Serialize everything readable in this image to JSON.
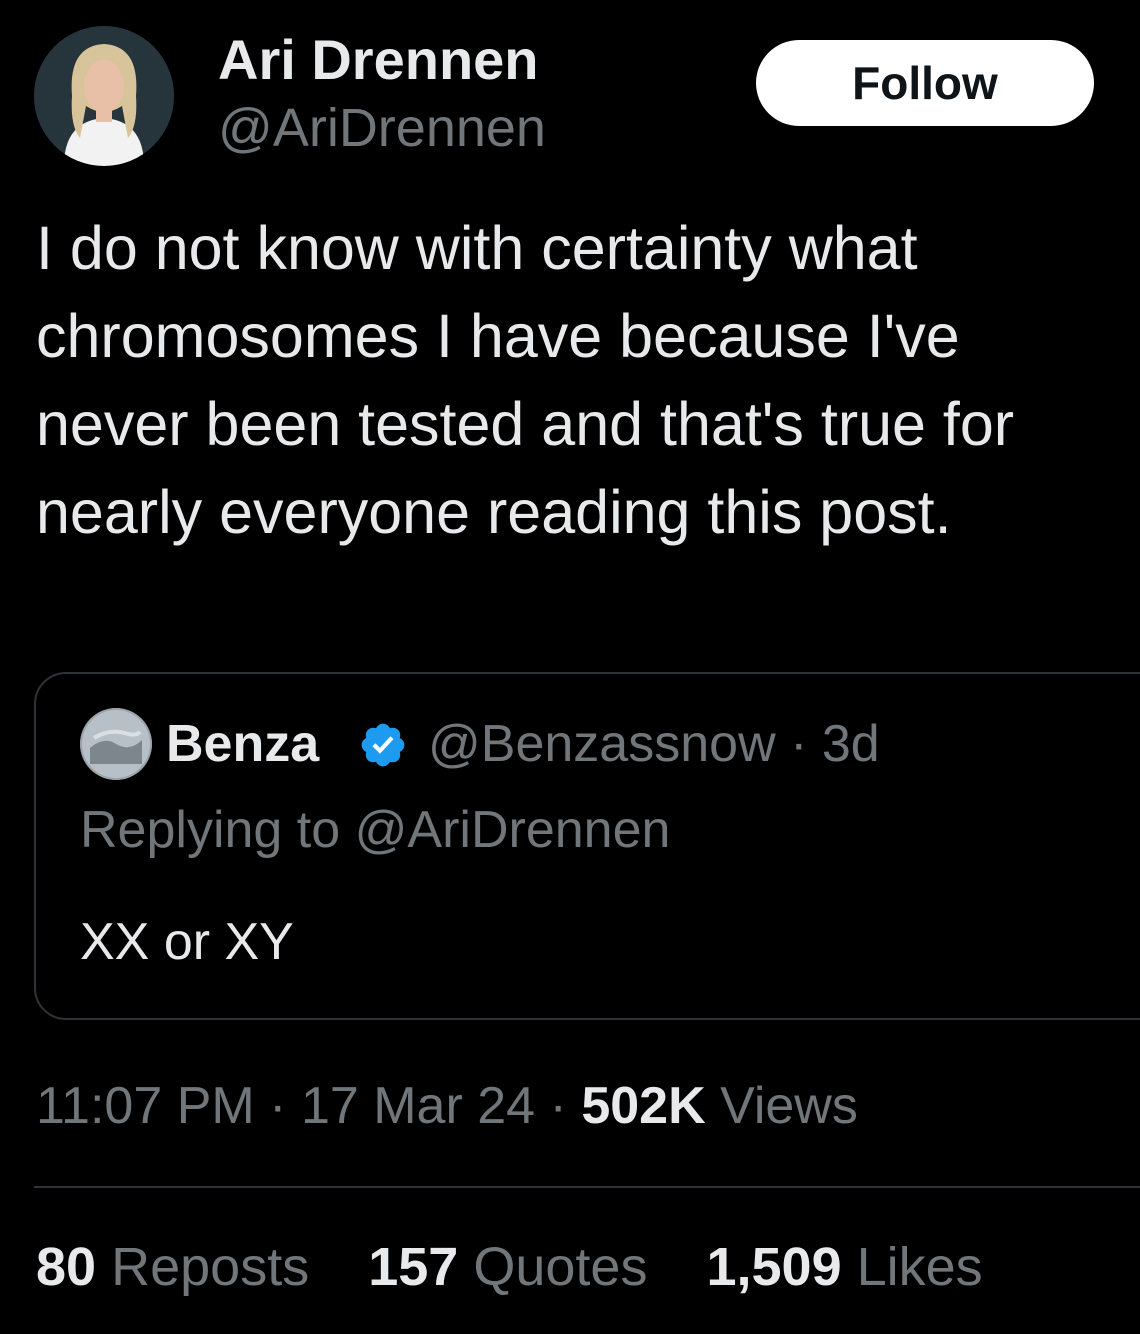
{
  "author": {
    "display_name": "Ari Drennen",
    "handle": "@AriDrennen"
  },
  "follow_label": "Follow",
  "tweet": {
    "text": "I do not know with certainty what chromosomes I have because I've never been tested and that's true for nearly everyone reading this post."
  },
  "quoted": {
    "name": "Benza",
    "handle": "@Benzassnow",
    "separator": "·",
    "age": "3d",
    "reply_prefix": "Replying to",
    "reply_handle": "@AriDrennen",
    "text": "XX or XY",
    "verified_icon": "verified-badge-icon",
    "verified_color": "#1d9bf0"
  },
  "meta": {
    "time": "11:07 PM",
    "sep1": "·",
    "date": "17 Mar 24",
    "sep2": "·",
    "views_count": "502K",
    "views_label": "Views"
  },
  "stats": {
    "reposts_count": "80",
    "reposts_label": "Reposts",
    "quotes_count": "157",
    "quotes_label": "Quotes",
    "likes_count": "1,509",
    "likes_label": "Likes"
  },
  "colors": {
    "background": "#000000",
    "primary_text": "#e7e9ea",
    "secondary_text": "#71767b",
    "border": "#2f3336",
    "follow_bg": "#ffffff"
  }
}
